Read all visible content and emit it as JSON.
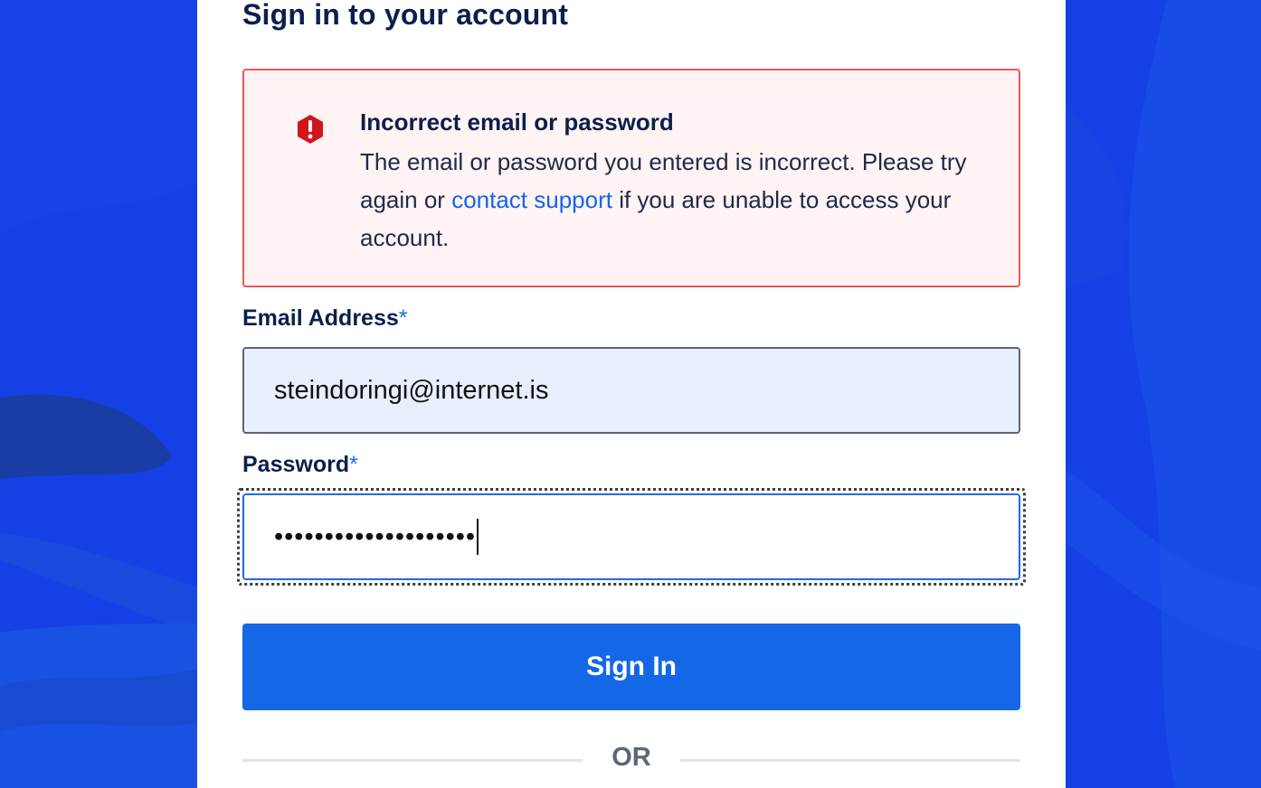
{
  "page": {
    "title": "Sign in to your account"
  },
  "alert": {
    "icon": "error-hexagon-icon",
    "title": "Incorrect email or password",
    "body_before": "The email or password you entered is incorrect. Please try again or ",
    "link_text": "contact support",
    "body_after": " if you are unable to access your account."
  },
  "email": {
    "label": "Email Address",
    "required_marker": "*",
    "value": "steindoringi@internet.is"
  },
  "password": {
    "label": "Password",
    "required_marker": "*",
    "masked_value": "••••••••••••••••••••"
  },
  "buttons": {
    "sign_in": "Sign In"
  },
  "divider": {
    "text": "OR"
  },
  "colors": {
    "background": "#1540e6",
    "primary": "#1467e6",
    "error_border": "#e65a5a",
    "error_bg": "#fff3f3",
    "heading": "#0b1f4d"
  }
}
